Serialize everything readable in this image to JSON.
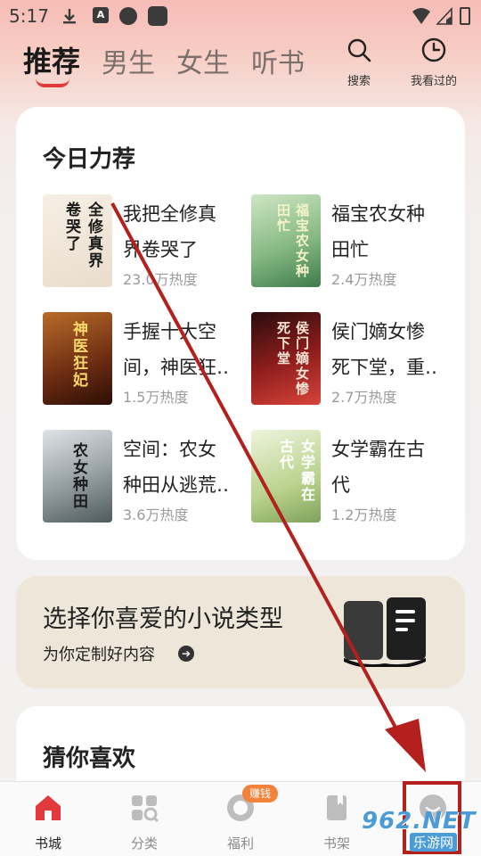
{
  "status_bar": {
    "time": "5:17",
    "a_badge": "A"
  },
  "top_tabs": [
    {
      "label": "推荐",
      "active": true
    },
    {
      "label": "男生",
      "active": false
    },
    {
      "label": "女生",
      "active": false
    },
    {
      "label": "听书",
      "active": false
    }
  ],
  "top_actions": {
    "search_label": "搜索",
    "history_label": "我看过的"
  },
  "recommend": {
    "title": "今日力荐",
    "books": [
      {
        "title_line1": "我把全修真",
        "title_line2": "界卷哭了",
        "heat": "23.0万热度",
        "cover_text": "全修真界卷哭了"
      },
      {
        "title_line1": "福宝农女种",
        "title_line2": "田忙",
        "heat": "2.4万热度",
        "cover_text": "福宝农女种田忙"
      },
      {
        "title_line1": "手握十大空",
        "title_line2": "间，神医狂…",
        "heat": "1.5万热度",
        "cover_text": "神医狂妃"
      },
      {
        "title_line1": "侯门嫡女惨",
        "title_line2": "死下堂，重…",
        "heat": "2.7万热度",
        "cover_text": "侯门嫡女惨死下堂"
      },
      {
        "title_line1": "空间：农女",
        "title_line2": "种田从逃荒…",
        "heat": "3.6万热度",
        "cover_text": "农女种田"
      },
      {
        "title_line1": "女学霸在古",
        "title_line2": "代",
        "heat": "1.2万热度",
        "cover_text": "女学霸在古代"
      }
    ]
  },
  "banner": {
    "title": "选择你喜爱的小说类型",
    "subtitle": "为你定制好内容",
    "arrow": "➔"
  },
  "guess": {
    "title": "猜你喜欢"
  },
  "bottom_nav": [
    {
      "label": "书城",
      "active": true
    },
    {
      "label": "分类",
      "active": false
    },
    {
      "label": "福利",
      "active": false
    },
    {
      "label": "书架",
      "active": false
    },
    {
      "label": "我的",
      "active": false
    }
  ],
  "earn_badge": "赚钱",
  "watermark": {
    "number": "962.NET",
    "site": "乐游网"
  },
  "colors": {
    "accent_red": "#e2393d",
    "annotation_red": "#b3201e",
    "banner_bg": "#efe6da",
    "badge_orange": "#f2823a"
  }
}
